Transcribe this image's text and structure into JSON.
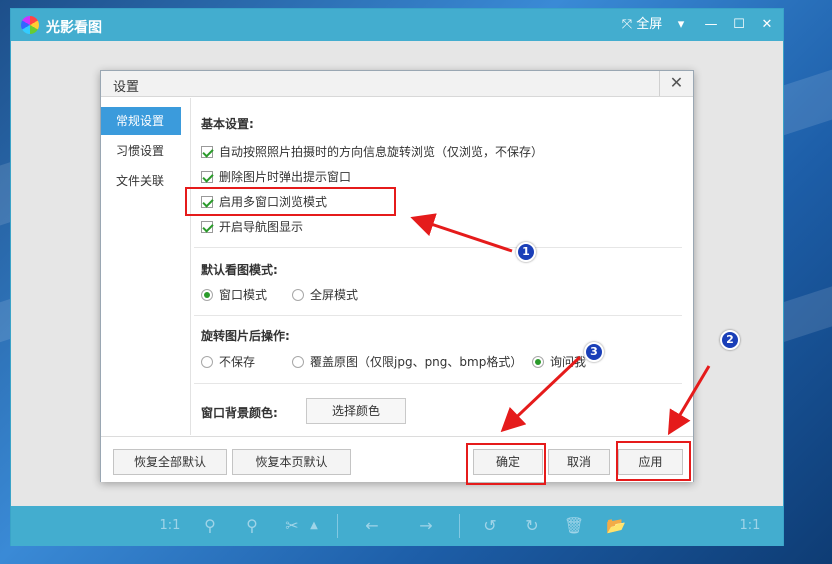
{
  "app": {
    "title": "光影看图",
    "fullscreen_label": "全屏"
  },
  "dialog": {
    "title": "设置",
    "nav": [
      {
        "label": "常规设置",
        "active": true
      },
      {
        "label": "习惯设置",
        "active": false
      },
      {
        "label": "文件关联",
        "active": false
      }
    ],
    "basic": {
      "title": "基本设置:",
      "options": [
        {
          "label": "自动按照照片拍摄时的方向信息旋转浏览（仅浏览，不保存）",
          "checked": true
        },
        {
          "label": "删除图片时弹出提示窗口",
          "checked": true
        },
        {
          "label": "启用多窗口浏览模式",
          "checked": true
        },
        {
          "label": "开启导航图显示",
          "checked": true
        }
      ]
    },
    "view_mode": {
      "title": "默认看图模式:",
      "options": [
        {
          "label": "窗口模式",
          "selected": true
        },
        {
          "label": "全屏模式",
          "selected": false
        }
      ]
    },
    "rotate": {
      "title": "旋转图片后操作:",
      "options": [
        {
          "label": "不保存",
          "selected": false
        },
        {
          "label": "覆盖原图（仅限jpg、png、bmp格式）",
          "selected": false
        },
        {
          "label": "询问我",
          "selected": true
        }
      ]
    },
    "background": {
      "title": "窗口背景颜色:",
      "button_label": "选择颜色"
    },
    "footer": {
      "restore_all": "恢复全部默认",
      "restore_page": "恢复本页默认",
      "ok": "确定",
      "cancel": "取消",
      "apply": "应用"
    }
  },
  "toolbar": {
    "zoom_label": "1:1",
    "actual_label": "1:1"
  },
  "annotations": {
    "badge1": "1",
    "badge2": "2",
    "badge3": "3",
    "color": "#e51b1b",
    "badge_color": "#1a3fb8"
  }
}
